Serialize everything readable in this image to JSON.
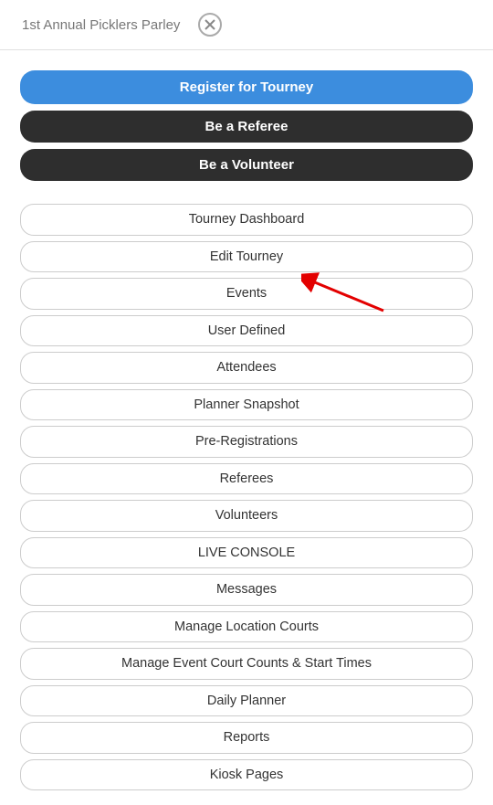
{
  "header": {
    "title": "1st Annual Picklers Parley"
  },
  "primaryActions": {
    "register": "Register for Tourney",
    "referee": "Be a Referee",
    "volunteer": "Be a Volunteer"
  },
  "menuItems": [
    "Tourney Dashboard",
    "Edit Tourney",
    "Events",
    "User Defined",
    "Attendees",
    "Planner Snapshot",
    "Pre-Registrations",
    "Referees",
    "Volunteers",
    "LIVE CONSOLE",
    "Messages",
    "Manage Location Courts",
    "Manage Event Court Counts & Start Times",
    "Daily Planner",
    "Reports",
    "Kiosk Pages"
  ]
}
